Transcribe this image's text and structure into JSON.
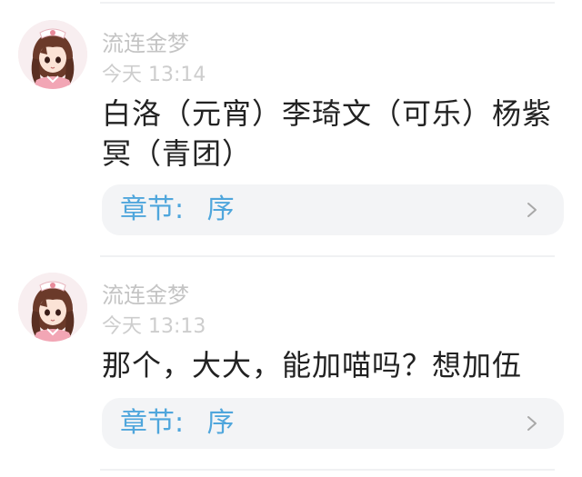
{
  "comments": [
    {
      "username": "流连金梦",
      "timestamp": "今天 13:14",
      "content": "白洛（元宵）李琦文（可乐）杨紫冥（青团）",
      "chapter_label": "章节:",
      "chapter_name": "序"
    },
    {
      "username": "流连金梦",
      "timestamp": "今天 13:13",
      "content": "那个，大大，能加喵吗？想加伍",
      "chapter_label": "章节:",
      "chapter_name": "序"
    }
  ],
  "icons": {
    "avatar": "anime-girl-avatar-icon",
    "chapter_arrow": "chevron-right-icon"
  },
  "colors": {
    "chapter_link_text": "#4fa6dc",
    "username_text": "#c4c4c4",
    "content_text": "#222222",
    "chapter_link_bg": "#f3f4f6"
  }
}
